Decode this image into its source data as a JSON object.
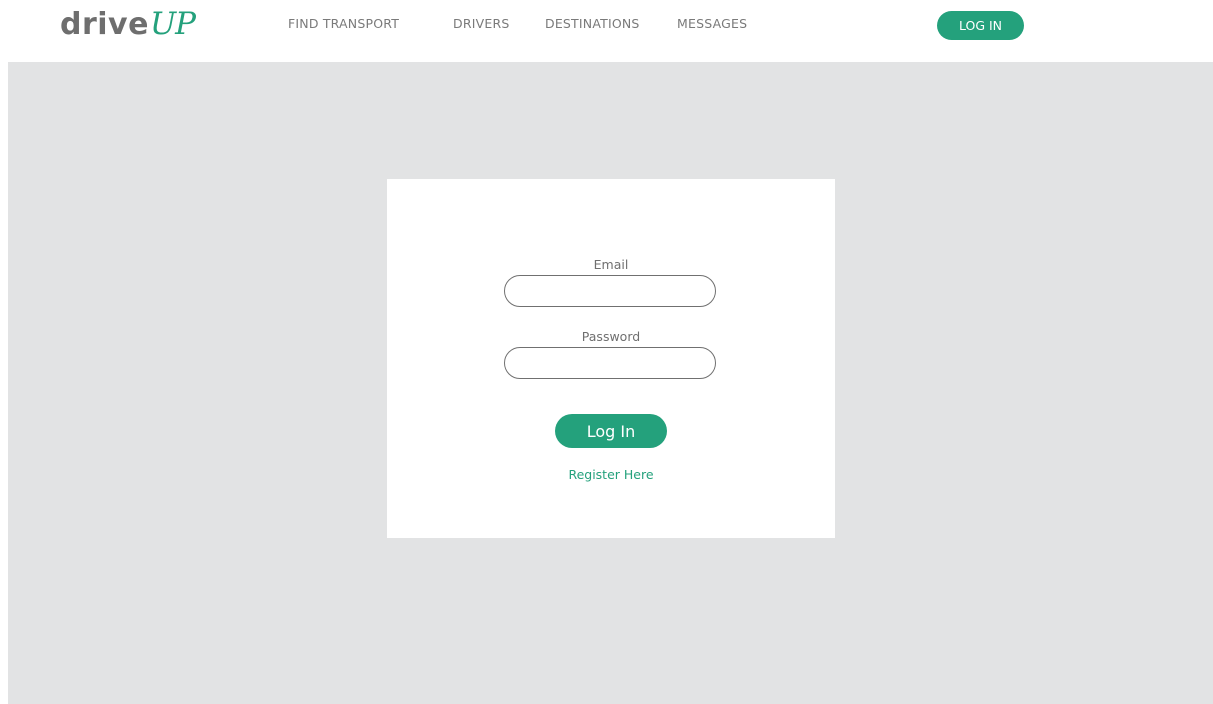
{
  "brand": {
    "logo_drive": "drive",
    "logo_up": "UP",
    "accent_color": "#24a17c"
  },
  "nav": {
    "items": [
      {
        "label": "FIND TRANSPORT"
      },
      {
        "label": "DRIVERS"
      },
      {
        "label": "DESTINATIONS"
      },
      {
        "label": "MESSAGES"
      }
    ],
    "login_label": "LOG IN"
  },
  "login_form": {
    "email_label": "Email",
    "email_value": "",
    "password_label": "Password",
    "password_value": "",
    "submit_label": "Log In",
    "register_label": "Register Here"
  }
}
